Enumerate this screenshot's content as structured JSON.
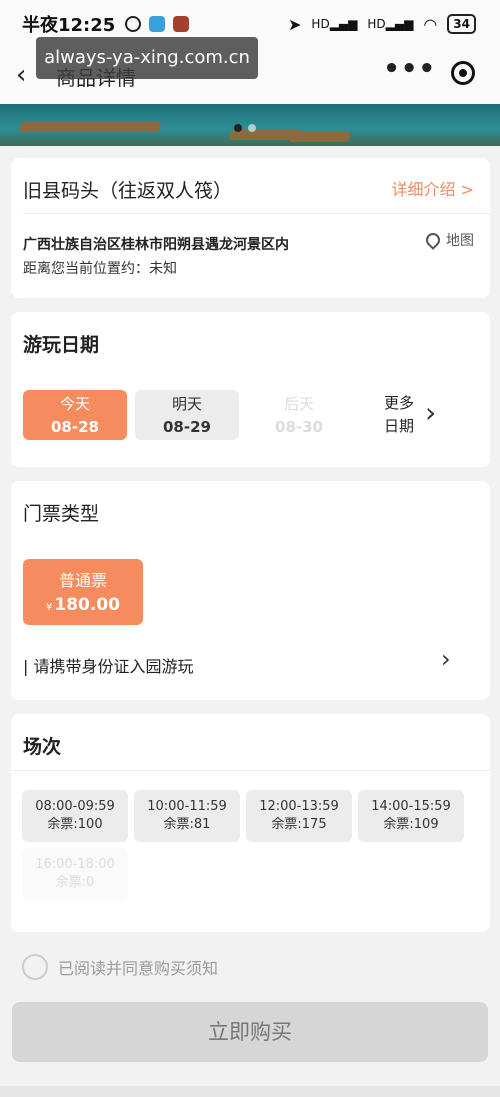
{
  "status": {
    "time": "半夜12:25",
    "battery": "34",
    "signal1": "HD",
    "signal2": "HD"
  },
  "watermark": "always-ya-xing.com.cn",
  "nav": {
    "title": "商品详情",
    "back_icon": "chevron-left-icon",
    "more_icon": "more-dots-icon",
    "close_icon": "target-icon"
  },
  "product": {
    "title": "旧县码头（往返双人筏）",
    "detail_link": "详细介绍 >",
    "address": "广西壮族自治区桂林市阳朔县遇龙河景区内",
    "map_label": "地图",
    "distance": "距离您当前位置约：未知"
  },
  "dates": {
    "title": "游玩日期",
    "options": [
      {
        "day": "今天",
        "date": "08-28",
        "state": "selected"
      },
      {
        "day": "明天",
        "date": "08-29",
        "state": "normal"
      },
      {
        "day": "后天",
        "date": "08-30",
        "state": "disabled"
      }
    ],
    "more_line1": "更多",
    "more_line2": "日期"
  },
  "tickets": {
    "title": "门票类型",
    "options": [
      {
        "name": "普通票",
        "currency": "¥",
        "price": "180.00"
      }
    ],
    "notice": "请携带身份证入园游玩"
  },
  "sessions": {
    "title": "场次",
    "options": [
      {
        "time": "08:00-09:59",
        "remaining": "余票:100",
        "state": "normal"
      },
      {
        "time": "10:00-11:59",
        "remaining": "余票:81",
        "state": "normal"
      },
      {
        "time": "12:00-13:59",
        "remaining": "余票:175",
        "state": "normal"
      },
      {
        "time": "14:00-15:59",
        "remaining": "余票:109",
        "state": "normal"
      },
      {
        "time": "16:00-18:00",
        "remaining": "余票:0",
        "state": "disabled"
      }
    ]
  },
  "agreement": "已阅读并同意购买须知",
  "buy_button": "立即购买"
}
